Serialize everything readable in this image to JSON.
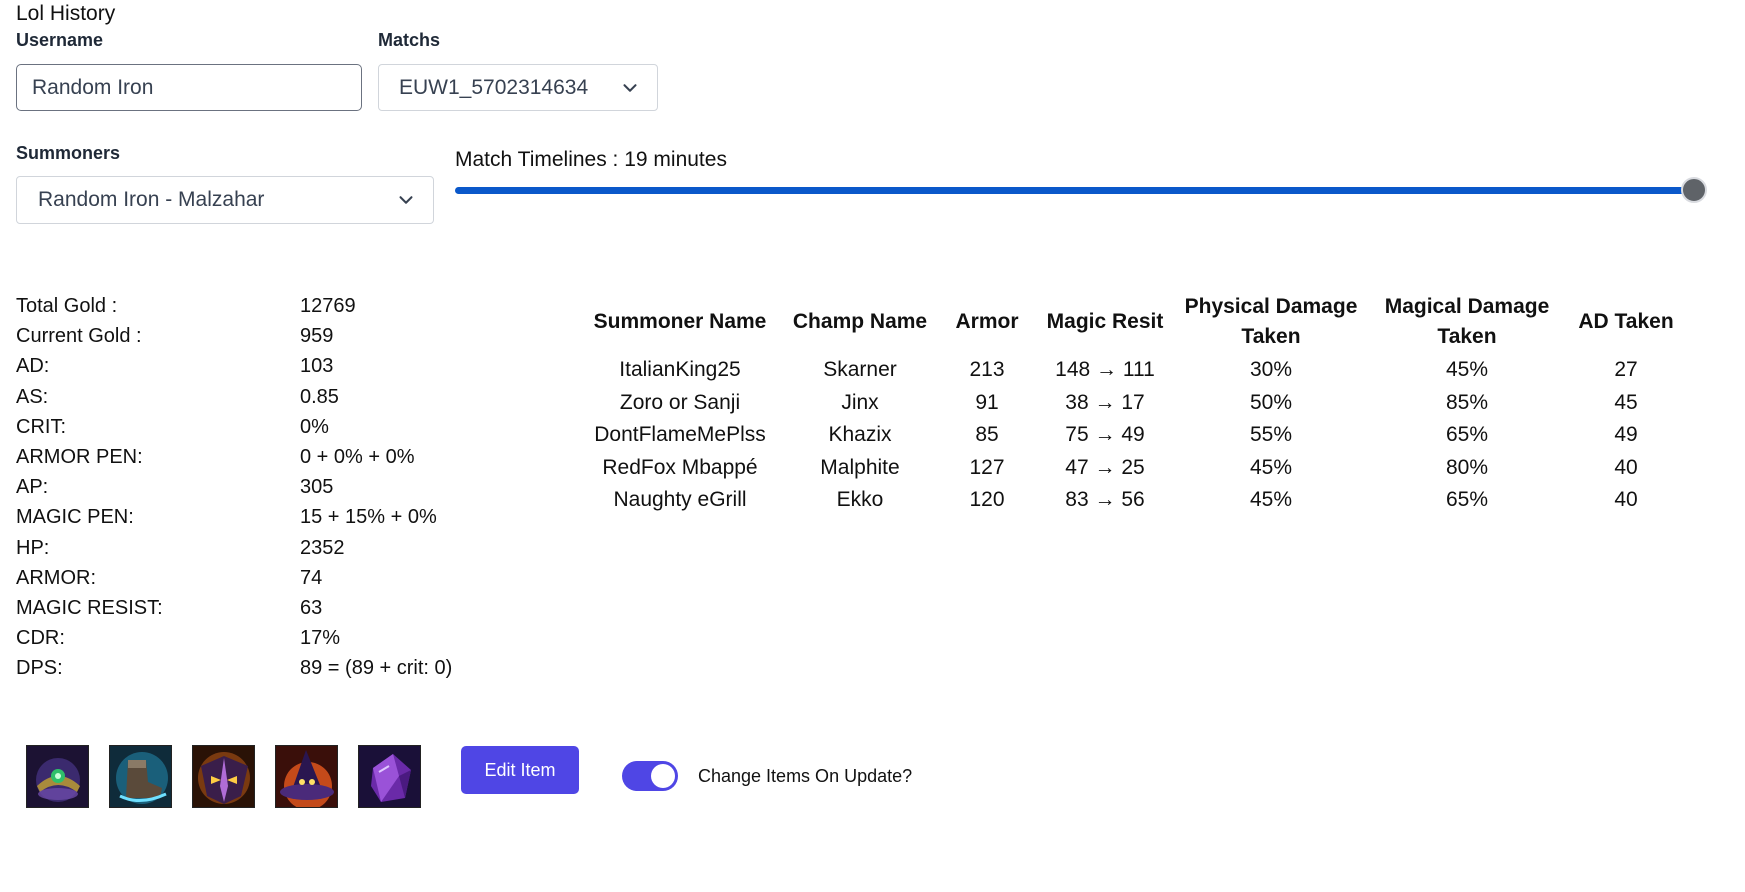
{
  "app": {
    "title": "Lol History"
  },
  "form": {
    "username_label": "Username",
    "username_value": "Random Iron",
    "matchs_label": "Matchs",
    "matchs_selected": "EUW1_5702314634",
    "summoners_label": "Summoners",
    "summoners_selected": "Random Iron - Malzahar"
  },
  "timeline": {
    "label": "Match Timelines : 19 minutes",
    "position_fraction": 1.0
  },
  "stats": [
    {
      "label": "Total Gold :",
      "value": "12769"
    },
    {
      "label": "Current Gold :",
      "value": "959"
    },
    {
      "label": "AD:",
      "value": "103"
    },
    {
      "label": "AS:",
      "value": "0.85"
    },
    {
      "label": "CRIT:",
      "value": "0%"
    },
    {
      "label": "ARMOR PEN:",
      "value": "0 + 0% + 0%"
    },
    {
      "label": "AP:",
      "value": "305"
    },
    {
      "label": "MAGIC PEN:",
      "value": "15 + 15% + 0%"
    },
    {
      "label": "HP:",
      "value": "2352"
    },
    {
      "label": "ARMOR:",
      "value": "74"
    },
    {
      "label": "MAGIC RESIST:",
      "value": "63"
    },
    {
      "label": "CDR:",
      "value": "17%"
    },
    {
      "label": "DPS:",
      "value": "89 = (89 + crit: 0)"
    }
  ],
  "table": {
    "headers": [
      "Summoner Name",
      "Champ Name",
      "Armor",
      "Magic Resit",
      "Physical Damage Taken",
      "Magical Damage Taken",
      "AD Taken"
    ],
    "rows": [
      [
        "ItalianKing25",
        "Skarner",
        "213",
        "148 → 111",
        "30%",
        "45%",
        "27"
      ],
      [
        "Zoro or Sanji",
        "Jinx",
        "91",
        "38 → 17",
        "50%",
        "85%",
        "45"
      ],
      [
        "DontFlameMePlss",
        "Khazix",
        "85",
        "75 → 49",
        "55%",
        "65%",
        "49"
      ],
      [
        "RedFox Mbappé",
        "Malphite",
        "127",
        "47 → 25",
        "45%",
        "80%",
        "40"
      ],
      [
        "Naughty eGrill",
        "Ekko",
        "120",
        "83 → 56",
        "45%",
        "65%",
        "40"
      ]
    ]
  },
  "items": [
    {
      "icon": "crown-item-icon"
    },
    {
      "icon": "boots-item-icon"
    },
    {
      "icon": "mask-item-icon"
    },
    {
      "icon": "hat-item-icon"
    },
    {
      "icon": "crystal-item-icon"
    }
  ],
  "actions": {
    "edit_item_label": "Edit Item",
    "toggle_label": "Change Items On Update?",
    "toggle_on": true
  },
  "colors": {
    "accent": "#4f46e5",
    "slider_track": "#0a58ca",
    "slider_thumb": "#5f6368"
  }
}
